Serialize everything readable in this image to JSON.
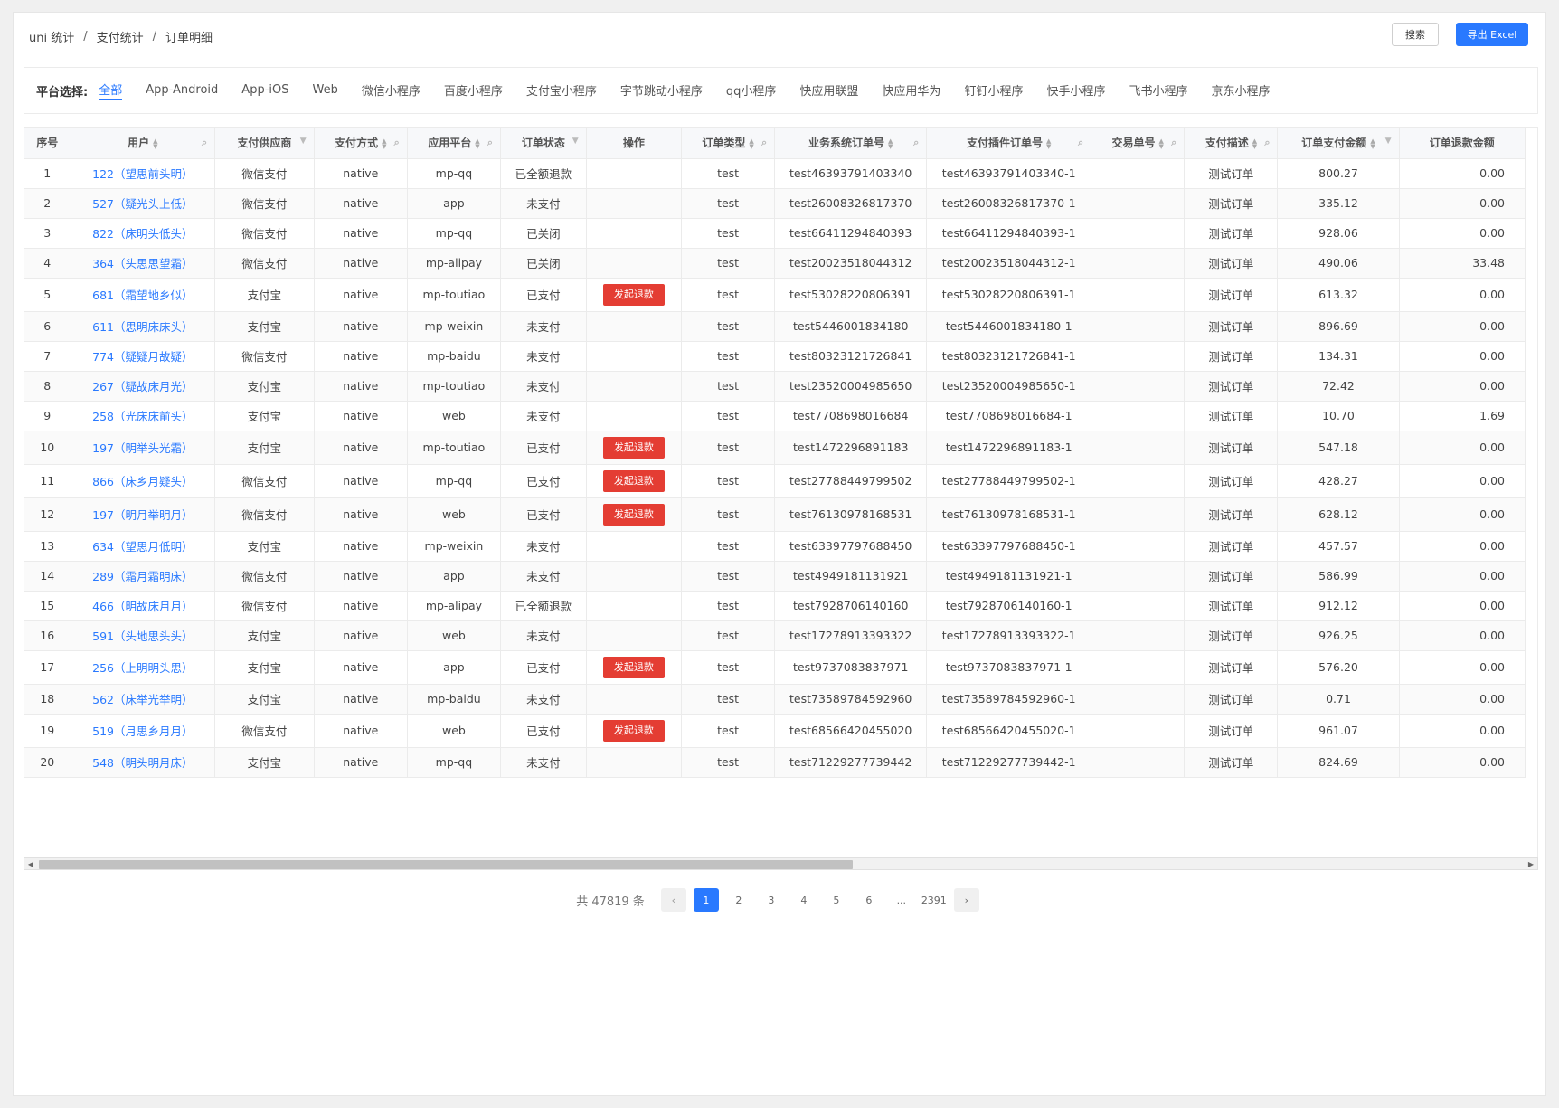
{
  "breadcrumb": [
    "uni 统计",
    "支付统计",
    "订单明细"
  ],
  "breadcrumb_sep": "/",
  "toolbar": {
    "search_label": "搜索",
    "export_label": "导出 Excel"
  },
  "platform": {
    "label": "平台选择:",
    "items": [
      "全部",
      "App-Android",
      "App-iOS",
      "Web",
      "微信小程序",
      "百度小程序",
      "支付宝小程序",
      "字节跳动小程序",
      "qq小程序",
      "快应用联盟",
      "快应用华为",
      "钉钉小程序",
      "快手小程序",
      "飞书小程序",
      "京东小程序"
    ],
    "active": "全部"
  },
  "table": {
    "columns": [
      {
        "label": "序号",
        "icon": "none"
      },
      {
        "label": "用户",
        "icon": "sort-search"
      },
      {
        "label": "支付供应商",
        "icon": "filter"
      },
      {
        "label": "支付方式",
        "icon": "sort-search"
      },
      {
        "label": "应用平台",
        "icon": "sort-search"
      },
      {
        "label": "订单状态",
        "icon": "filter"
      },
      {
        "label": "操作",
        "icon": "none"
      },
      {
        "label": "订单类型",
        "icon": "sort-search"
      },
      {
        "label": "业务系统订单号",
        "icon": "sort-search"
      },
      {
        "label": "支付插件订单号",
        "icon": "sort-search"
      },
      {
        "label": "交易单号",
        "icon": "sort-search"
      },
      {
        "label": "支付描述",
        "icon": "sort-search"
      },
      {
        "label": "订单支付金额",
        "icon": "sort-filter"
      },
      {
        "label": "订单退款金额",
        "icon": "none"
      }
    ],
    "refund_label": "发起退款",
    "rows": [
      {
        "no": "1",
        "user": "122（望思前头明）",
        "provider": "微信支付",
        "method": "native",
        "platform": "mp-qq",
        "status": "已全额退款",
        "refund": false,
        "type": "test",
        "biz_no": "test46393791403340",
        "plugin_no": "test46393791403340-1",
        "trade_no": "",
        "desc": "测试订单",
        "pay": "800.27",
        "refund_amt": "0.00"
      },
      {
        "no": "2",
        "user": "527（疑光头上低）",
        "provider": "微信支付",
        "method": "native",
        "platform": "app",
        "status": "未支付",
        "refund": false,
        "type": "test",
        "biz_no": "test26008326817370",
        "plugin_no": "test26008326817370-1",
        "trade_no": "",
        "desc": "测试订单",
        "pay": "335.12",
        "refund_amt": "0.00"
      },
      {
        "no": "3",
        "user": "822（床明头低头）",
        "provider": "微信支付",
        "method": "native",
        "platform": "mp-qq",
        "status": "已关闭",
        "refund": false,
        "type": "test",
        "biz_no": "test66411294840393",
        "plugin_no": "test66411294840393-1",
        "trade_no": "",
        "desc": "测试订单",
        "pay": "928.06",
        "refund_amt": "0.00"
      },
      {
        "no": "4",
        "user": "364（头思思望霜）",
        "provider": "微信支付",
        "method": "native",
        "platform": "mp-alipay",
        "status": "已关闭",
        "refund": false,
        "type": "test",
        "biz_no": "test20023518044312",
        "plugin_no": "test20023518044312-1",
        "trade_no": "",
        "desc": "测试订单",
        "pay": "490.06",
        "refund_amt": "33.48"
      },
      {
        "no": "5",
        "user": "681（霜望地乡似）",
        "provider": "支付宝",
        "method": "native",
        "platform": "mp-toutiao",
        "status": "已支付",
        "refund": true,
        "type": "test",
        "biz_no": "test53028220806391",
        "plugin_no": "test53028220806391-1",
        "trade_no": "",
        "desc": "测试订单",
        "pay": "613.32",
        "refund_amt": "0.00"
      },
      {
        "no": "6",
        "user": "611（思明床床头）",
        "provider": "支付宝",
        "method": "native",
        "platform": "mp-weixin",
        "status": "未支付",
        "refund": false,
        "type": "test",
        "biz_no": "test5446001834180",
        "plugin_no": "test5446001834180-1",
        "trade_no": "",
        "desc": "测试订单",
        "pay": "896.69",
        "refund_amt": "0.00"
      },
      {
        "no": "7",
        "user": "774（疑疑月故疑）",
        "provider": "微信支付",
        "method": "native",
        "platform": "mp-baidu",
        "status": "未支付",
        "refund": false,
        "type": "test",
        "biz_no": "test80323121726841",
        "plugin_no": "test80323121726841-1",
        "trade_no": "",
        "desc": "测试订单",
        "pay": "134.31",
        "refund_amt": "0.00"
      },
      {
        "no": "8",
        "user": "267（疑故床月光）",
        "provider": "支付宝",
        "method": "native",
        "platform": "mp-toutiao",
        "status": "未支付",
        "refund": false,
        "type": "test",
        "biz_no": "test23520004985650",
        "plugin_no": "test23520004985650-1",
        "trade_no": "",
        "desc": "测试订单",
        "pay": "72.42",
        "refund_amt": "0.00"
      },
      {
        "no": "9",
        "user": "258（光床床前头）",
        "provider": "支付宝",
        "method": "native",
        "platform": "web",
        "status": "未支付",
        "refund": false,
        "type": "test",
        "biz_no": "test7708698016684",
        "plugin_no": "test7708698016684-1",
        "trade_no": "",
        "desc": "测试订单",
        "pay": "10.70",
        "refund_amt": "1.69"
      },
      {
        "no": "10",
        "user": "197（明举头光霜）",
        "provider": "支付宝",
        "method": "native",
        "platform": "mp-toutiao",
        "status": "已支付",
        "refund": true,
        "type": "test",
        "biz_no": "test1472296891183",
        "plugin_no": "test1472296891183-1",
        "trade_no": "",
        "desc": "测试订单",
        "pay": "547.18",
        "refund_amt": "0.00"
      },
      {
        "no": "11",
        "user": "866（床乡月疑头）",
        "provider": "微信支付",
        "method": "native",
        "platform": "mp-qq",
        "status": "已支付",
        "refund": true,
        "type": "test",
        "biz_no": "test27788449799502",
        "plugin_no": "test27788449799502-1",
        "trade_no": "",
        "desc": "测试订单",
        "pay": "428.27",
        "refund_amt": "0.00"
      },
      {
        "no": "12",
        "user": "197（明月举明月）",
        "provider": "微信支付",
        "method": "native",
        "platform": "web",
        "status": "已支付",
        "refund": true,
        "type": "test",
        "biz_no": "test76130978168531",
        "plugin_no": "test76130978168531-1",
        "trade_no": "",
        "desc": "测试订单",
        "pay": "628.12",
        "refund_amt": "0.00"
      },
      {
        "no": "13",
        "user": "634（望思月低明）",
        "provider": "支付宝",
        "method": "native",
        "platform": "mp-weixin",
        "status": "未支付",
        "refund": false,
        "type": "test",
        "biz_no": "test63397797688450",
        "plugin_no": "test63397797688450-1",
        "trade_no": "",
        "desc": "测试订单",
        "pay": "457.57",
        "refund_amt": "0.00"
      },
      {
        "no": "14",
        "user": "289（霜月霜明床）",
        "provider": "微信支付",
        "method": "native",
        "platform": "app",
        "status": "未支付",
        "refund": false,
        "type": "test",
        "biz_no": "test4949181131921",
        "plugin_no": "test4949181131921-1",
        "trade_no": "",
        "desc": "测试订单",
        "pay": "586.99",
        "refund_amt": "0.00"
      },
      {
        "no": "15",
        "user": "466（明故床月月）",
        "provider": "微信支付",
        "method": "native",
        "platform": "mp-alipay",
        "status": "已全额退款",
        "refund": false,
        "type": "test",
        "biz_no": "test7928706140160",
        "plugin_no": "test7928706140160-1",
        "trade_no": "",
        "desc": "测试订单",
        "pay": "912.12",
        "refund_amt": "0.00"
      },
      {
        "no": "16",
        "user": "591（头地思头头）",
        "provider": "支付宝",
        "method": "native",
        "platform": "web",
        "status": "未支付",
        "refund": false,
        "type": "test",
        "biz_no": "test17278913393322",
        "plugin_no": "test17278913393322-1",
        "trade_no": "",
        "desc": "测试订单",
        "pay": "926.25",
        "refund_amt": "0.00"
      },
      {
        "no": "17",
        "user": "256（上明明头思）",
        "provider": "支付宝",
        "method": "native",
        "platform": "app",
        "status": "已支付",
        "refund": true,
        "type": "test",
        "biz_no": "test9737083837971",
        "plugin_no": "test9737083837971-1",
        "trade_no": "",
        "desc": "测试订单",
        "pay": "576.20",
        "refund_amt": "0.00"
      },
      {
        "no": "18",
        "user": "562（床举光举明）",
        "provider": "支付宝",
        "method": "native",
        "platform": "mp-baidu",
        "status": "未支付",
        "refund": false,
        "type": "test",
        "biz_no": "test73589784592960",
        "plugin_no": "test73589784592960-1",
        "trade_no": "",
        "desc": "测试订单",
        "pay": "0.71",
        "refund_amt": "0.00"
      },
      {
        "no": "19",
        "user": "519（月思乡月月）",
        "provider": "微信支付",
        "method": "native",
        "platform": "web",
        "status": "已支付",
        "refund": true,
        "type": "test",
        "biz_no": "test68566420455020",
        "plugin_no": "test68566420455020-1",
        "trade_no": "",
        "desc": "测试订单",
        "pay": "961.07",
        "refund_amt": "0.00"
      },
      {
        "no": "20",
        "user": "548（明头明月床）",
        "provider": "支付宝",
        "method": "native",
        "platform": "mp-qq",
        "status": "未支付",
        "refund": false,
        "type": "test",
        "biz_no": "test71229277739442",
        "plugin_no": "test71229277739442-1",
        "trade_no": "",
        "desc": "测试订单",
        "pay": "824.69",
        "refund_amt": "0.00"
      }
    ]
  },
  "pagination": {
    "total_text": "共 47819 条",
    "pages": [
      "1",
      "2",
      "3",
      "4",
      "5",
      "6",
      "...",
      "2391"
    ],
    "current": "1",
    "prev_icon": "chevron-left-icon",
    "next_icon": "chevron-right-icon"
  },
  "colors": {
    "accent": "#2979ff",
    "danger": "#e43d33",
    "header_bg": "#f7f8fa"
  }
}
